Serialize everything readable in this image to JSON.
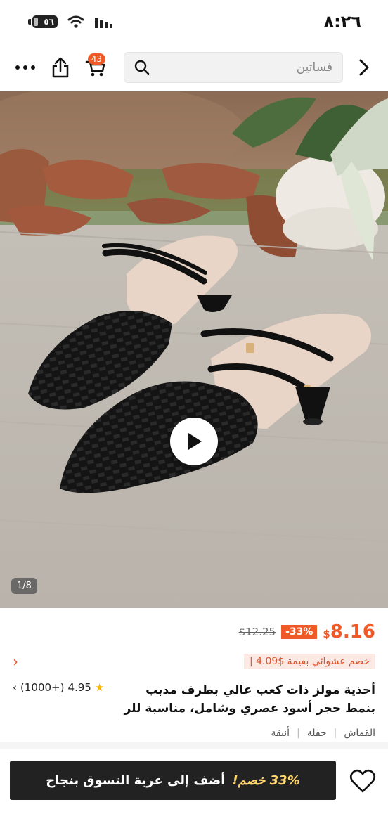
{
  "status": {
    "time": "٨:٢٦",
    "battery": "٥٦"
  },
  "top_bar": {
    "search_placeholder": "فساتين",
    "cart_count": "43"
  },
  "gallery": {
    "counter": "1/8"
  },
  "product": {
    "price_currency": "$",
    "price_value": "8.16",
    "discount": "-33%",
    "old_price": "$12.25",
    "coupon": "خصم عشوائي بقيمة $4.09 |",
    "title_line1": "أحذية مولز ذات كعب عالي بطرف مدبب",
    "title_line2": "بنمط حجر أسود عصري وشامل، مناسبة للر",
    "rating_value": "4.95",
    "rating_count": "(1000+)",
    "tags": [
      "القماش",
      "حفلة",
      "أنيقة"
    ]
  },
  "bottom": {
    "discount_label": "33% خصم!",
    "add_to_cart": "أضف إلى عربة التسوق بنجاح"
  },
  "colors": {
    "accent": "#f05a28",
    "dark_button": "#222222",
    "star": "#f7b500"
  }
}
